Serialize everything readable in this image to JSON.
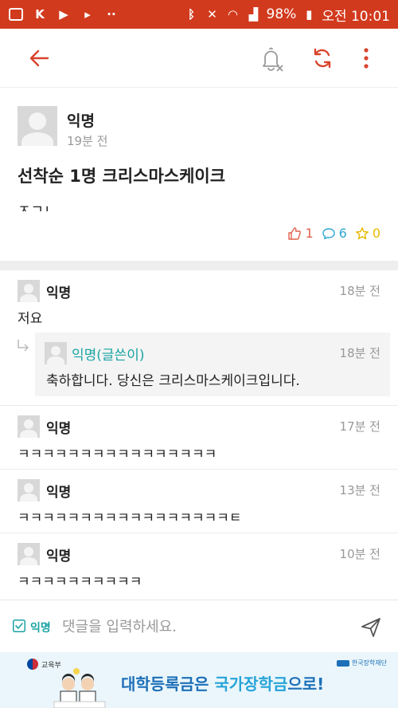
{
  "status_bar": {
    "battery": "98%",
    "time": "오전 10:01",
    "notification_icons": [
      "google-icon",
      "kakao-icon",
      "youtube-icon",
      "media-icon",
      "more-dots-icon"
    ],
    "system_icons": [
      "bluetooth-icon",
      "mute-icon",
      "wifi-icon",
      "signal-icon",
      "battery-icon"
    ]
  },
  "app_bar": {
    "icons": [
      "back-arrow-icon",
      "notification-off-icon",
      "refresh-icon",
      "more-vert-icon"
    ]
  },
  "post": {
    "author": "익명",
    "time": "19분 전",
    "title": "선착순 1명 크리스마스케이크",
    "body": "ㅈㄱㄴ",
    "likes": "1",
    "comments": "6",
    "scraps": "0"
  },
  "comments": [
    {
      "author": "익명",
      "time": "18분 전",
      "text": "저요",
      "reply": {
        "author": "익명(글쓴이)",
        "time": "18분 전",
        "text": "축하합니다. 당신은 크리스마스케이크입니다."
      }
    },
    {
      "author": "익명",
      "time": "17분 전",
      "text": "ㅋㅋㅋㅋㅋㅋㅋㅋㅋㅋㅋㅋㅋㅋㅋㅋ"
    },
    {
      "author": "익명",
      "time": "13분 전",
      "text": "ㅋㅋㅋㅋㅋㅋㅋㅋㅋㅋㅋㅋㅋㅋㅋㅋㅋㅌ"
    },
    {
      "author": "익명",
      "time": "10분 전",
      "text": "ㅋㅋㅋㅋㅋㅋㅋㅋㅋㅋ"
    }
  ],
  "input_bar": {
    "anonymous_label": "익명",
    "anonymous_checked": true,
    "placeholder": "댓글을 입력하세요."
  },
  "banner": {
    "ministry": "교육부",
    "text_prefix": "대학등록금은 ",
    "text_highlight": "국가장학금",
    "text_suffix": "으로!",
    "sponsor": "한국장학재단"
  },
  "colors": {
    "status_bar": "#d23a1e",
    "accent_red": "#d9432c",
    "teal": "#1aa3a3",
    "comment_blue": "#2aa6d2",
    "star_yellow": "#e6b800",
    "banner_blue": "#1d6fb8"
  }
}
